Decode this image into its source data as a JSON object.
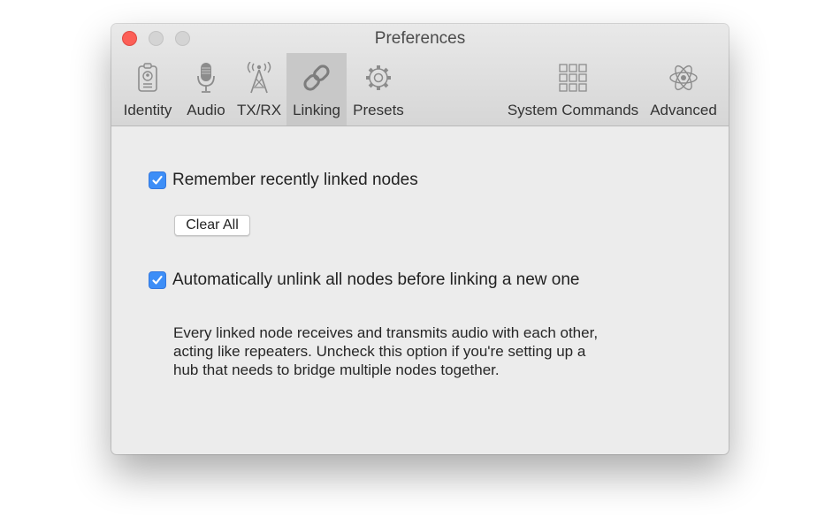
{
  "window": {
    "title": "Preferences"
  },
  "toolbar": {
    "tabs": [
      {
        "label": "Identity",
        "icon": "id-badge-icon",
        "active": false
      },
      {
        "label": "Audio",
        "icon": "microphone-icon",
        "active": false
      },
      {
        "label": "TX/RX",
        "icon": "antenna-tower-icon",
        "active": false
      },
      {
        "label": "Linking",
        "icon": "link-icon",
        "active": true
      },
      {
        "label": "Presets",
        "icon": "gear-icon",
        "active": false
      },
      {
        "label": "System Commands",
        "icon": "grid-icon",
        "active": false
      },
      {
        "label": "Advanced",
        "icon": "atom-icon",
        "active": false
      }
    ]
  },
  "linking": {
    "remember": {
      "label": "Remember recently linked nodes",
      "checked": true
    },
    "clear_all_label": "Clear All",
    "auto_unlink": {
      "label": "Automatically unlink all nodes before linking a new one",
      "checked": true
    },
    "description_lines": [
      "Every linked node receives and transmits audio with each other,",
      "acting like repeaters. Uncheck this option if you're setting up a",
      "hub that needs to bridge multiple nodes together."
    ]
  },
  "colors": {
    "accent": "#3d8ef7",
    "close_button": "#fc5f57",
    "icon_gray": "#8c8c8c"
  }
}
